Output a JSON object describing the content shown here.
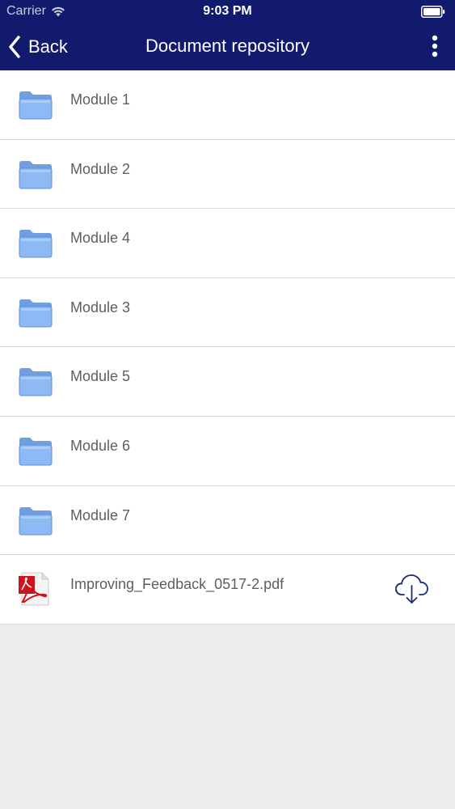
{
  "status_bar": {
    "carrier": "Carrier",
    "time": "9:03 PM",
    "wifi_icon": "wifi-icon",
    "battery_icon": "battery-icon"
  },
  "nav": {
    "back_label": "Back",
    "title": "Document repository",
    "back_icon": "chevron-left-icon",
    "menu_icon": "more-vertical-icon"
  },
  "items": [
    {
      "label": "Module 1",
      "icon": "folder-icon"
    },
    {
      "label": "Module 2",
      "icon": "folder-icon"
    },
    {
      "label": "Module 4",
      "icon": "folder-icon"
    },
    {
      "label": "Module 3",
      "icon": "folder-icon"
    },
    {
      "label": "Module 5",
      "icon": "folder-icon"
    },
    {
      "label": "Module 6",
      "icon": "folder-icon"
    },
    {
      "label": "Module 7",
      "icon": "folder-icon"
    },
    {
      "label": "Improving_Feedback_0517-2.pdf",
      "icon": "pdf-file-icon",
      "action_icon": "cloud-download-icon"
    }
  ],
  "colors": {
    "header_bg": "#121a6e",
    "folder_blue": "#7fb0f0",
    "pdf_red": "#d0121b",
    "download_icon": "#1a2a6e",
    "list_bg": "#ffffff",
    "page_bg": "#ededf0"
  }
}
